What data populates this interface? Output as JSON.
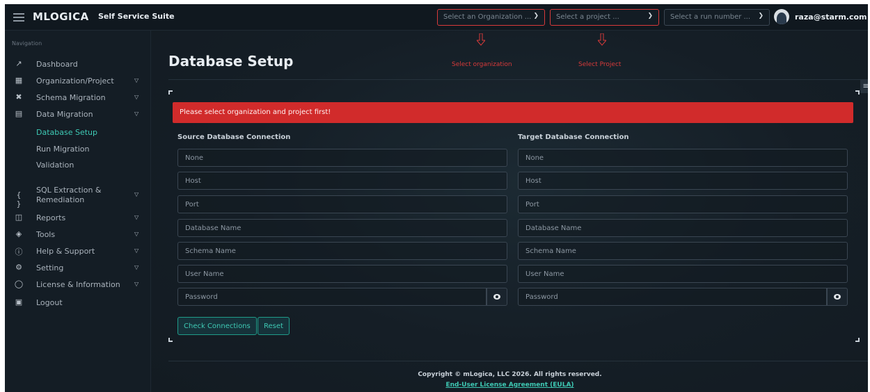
{
  "header": {
    "brand": "MLOGICA",
    "suite": "Self Service Suite",
    "org_select": "Select an Organization ...",
    "project_select": "Select a project ...",
    "run_select": "Select a run number ...",
    "user": "raza@starm.com"
  },
  "annotations": {
    "org": "Select organization",
    "project": "Select Project",
    "color": "#d73a3a"
  },
  "sidebar": {
    "heading": "Navigation",
    "items": [
      {
        "label": "Dashboard",
        "icon": "chart-icon"
      },
      {
        "label": "Organization/Project",
        "icon": "grid-icon"
      },
      {
        "label": "Schema Migration",
        "icon": "tools-icon"
      },
      {
        "label": "Data Migration",
        "icon": "database-icon"
      },
      {
        "label": "SQL Extraction &",
        "label2": "Remediation",
        "icon": "braces-icon"
      },
      {
        "label": "Reports",
        "icon": "report-icon"
      },
      {
        "label": "Tools",
        "icon": "layers-icon"
      },
      {
        "label": "Help & Support",
        "icon": "help-icon"
      },
      {
        "label": "Setting",
        "icon": "gear-icon"
      },
      {
        "label": "License & Information",
        "icon": "shield-icon"
      },
      {
        "label": "Logout",
        "icon": "logout-icon"
      }
    ],
    "sub_items": [
      "Database Setup",
      "Run Migration",
      "Validation"
    ]
  },
  "main": {
    "title": "Database Setup",
    "alert": "Please select organization and project first!",
    "source": {
      "heading": "Source Database Connection",
      "fields": [
        "None",
        "Host",
        "Port",
        "Database Name",
        "Schema Name",
        "User Name",
        "Password"
      ]
    },
    "target": {
      "heading": "Target Database Connection",
      "fields": [
        "None",
        "Host",
        "Port",
        "Database Name",
        "Schema Name",
        "User Name",
        "Password"
      ]
    },
    "buttons": {
      "check": "Check Connections",
      "reset": "Reset"
    }
  },
  "footer": {
    "copyright": "Copyright © mLogica, LLC 2026. All rights reserved.",
    "eula": "End-User License Agreement (EULA)"
  },
  "colors": {
    "accent": "#3ec9b4",
    "alert": "#d12b2b",
    "background": "#131c24"
  }
}
